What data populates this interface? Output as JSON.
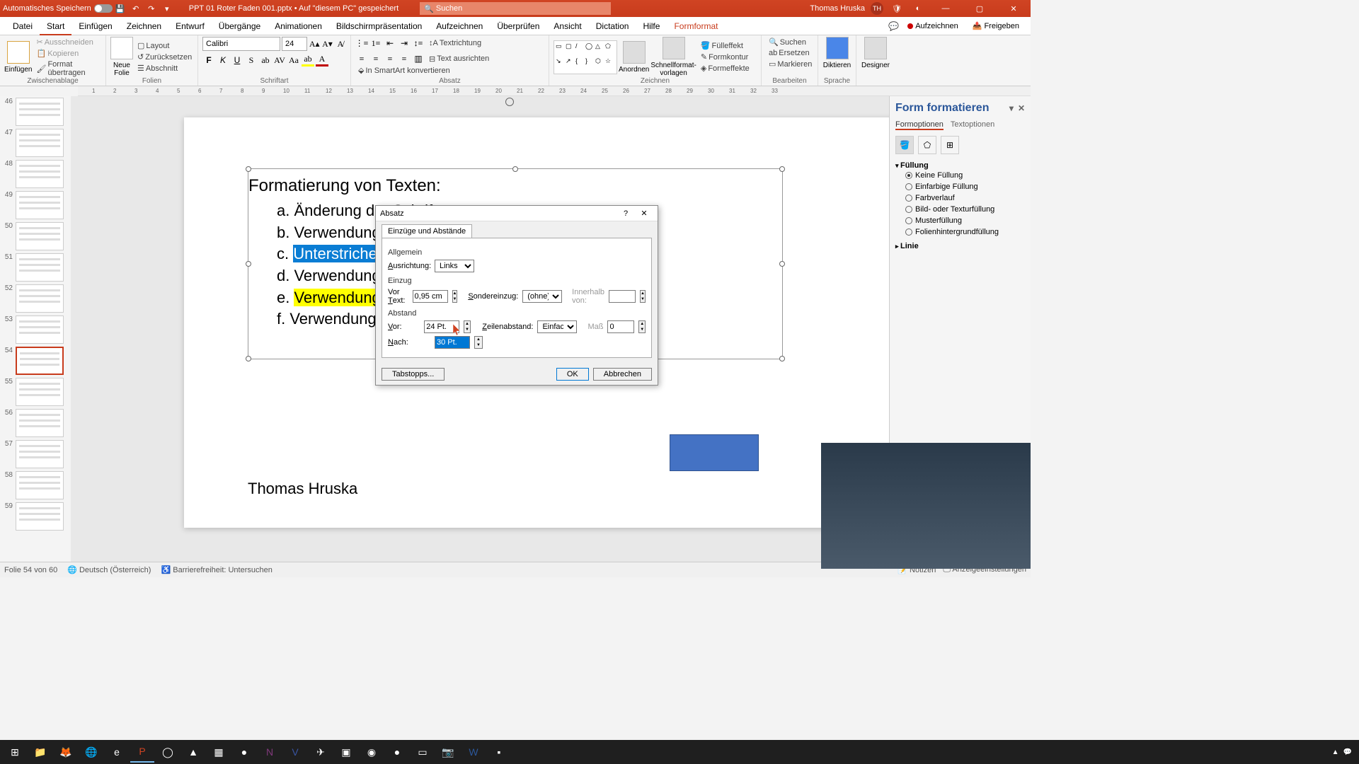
{
  "titlebar": {
    "autosave_label": "Automatisches Speichern",
    "filename": "PPT 01 Roter Faden 001.pptx • Auf \"diesem PC\" gespeichert",
    "search_placeholder": "Suchen",
    "user_name": "Thomas Hruska",
    "user_initials": "TH"
  },
  "tabs": {
    "items": [
      "Datei",
      "Start",
      "Einfügen",
      "Zeichnen",
      "Entwurf",
      "Übergänge",
      "Animationen",
      "Bildschirmpräsentation",
      "Aufzeichnen",
      "Überprüfen",
      "Ansicht",
      "Dictation",
      "Hilfe",
      "Formformat"
    ],
    "active": "Start",
    "aufzeichnen": "Aufzeichnen",
    "freigeben": "Freigeben"
  },
  "ribbon": {
    "clipboard": {
      "paste": "Einfügen",
      "cut": "Ausschneiden",
      "copy": "Kopieren",
      "format_painter": "Format übertragen",
      "label": "Zwischenablage"
    },
    "slides": {
      "new_slide": "Neue\nFolie",
      "layout": "Layout",
      "reset": "Zurücksetzen",
      "section": "Abschnitt",
      "label": "Folien"
    },
    "font": {
      "name": "Calibri",
      "size": "24",
      "label": "Schriftart"
    },
    "paragraph": {
      "label": "Absatz",
      "text_direction": "Textrichtung",
      "align_text": "Text ausrichten",
      "smartart": "In SmartArt konvertieren"
    },
    "drawing": {
      "arrange": "Anordnen",
      "quick_styles": "Schnellformat-\nvorlagen",
      "fill": "Fülleffekt",
      "outline": "Formkontur",
      "effects": "Formeffekte",
      "label": "Zeichnen"
    },
    "editing": {
      "find": "Suchen",
      "replace": "Ersetzen",
      "select": "Markieren",
      "label": "Bearbeiten"
    },
    "voice": {
      "dictate": "Diktieren",
      "label": "Sprache"
    },
    "designer": {
      "label": "Designer"
    }
  },
  "thumbs": [
    {
      "n": 46
    },
    {
      "n": 47
    },
    {
      "n": 48
    },
    {
      "n": 49
    },
    {
      "n": 50
    },
    {
      "n": 51
    },
    {
      "n": 52
    },
    {
      "n": 53
    },
    {
      "n": 54,
      "sel": true
    },
    {
      "n": 55
    },
    {
      "n": 56
    },
    {
      "n": 57
    },
    {
      "n": 58
    },
    {
      "n": 59
    }
  ],
  "slide": {
    "title": "Formatierung von Texten",
    "items": [
      {
        "letter": "a.",
        "text": "Änderung der Schrif"
      },
      {
        "letter": "b.",
        "text": "Verwendung von Fe"
      },
      {
        "letter": "c.",
        "text": "Unterstrichen und D",
        "hl": "blue"
      },
      {
        "letter": "d.",
        "text": "Verwendung von Sc"
      },
      {
        "letter": "e.",
        "text": "Verwendung von Te",
        "hl": "yellow"
      },
      {
        "letter": "f.",
        "text": "Verwendung von Abs                                          ählungen"
      }
    ],
    "author": "Thomas Hruska"
  },
  "dialog": {
    "title": "Absatz",
    "tab": "Einzüge und Abstände",
    "general_label": "Allgemein",
    "alignment_label": "Ausrichtung:",
    "alignment_value": "Links",
    "indent_label": "Einzug",
    "before_text_label": "Vor Text:",
    "before_text_value": "0,95 cm",
    "special_label": "Sondereinzug:",
    "special_value": "(ohne)",
    "by_label": "Innerhalb von:",
    "spacing_label": "Abstand",
    "before_label": "Vor:",
    "before_value": "24 Pt.",
    "line_spacing_label": "Zeilenabstand:",
    "line_spacing_value": "Einfach",
    "at_label": "Maß",
    "at_value": "0",
    "after_label": "Nach:",
    "after_value": "30 Pt.",
    "tabstops": "Tabstopps...",
    "ok": "OK",
    "cancel": "Abbrechen"
  },
  "format_pane": {
    "title": "Form formatieren",
    "subtabs": [
      "Formoptionen",
      "Textoptionen"
    ],
    "fill_label": "Füllung",
    "fill_options": [
      "Keine Füllung",
      "Einfarbige Füllung",
      "Farbverlauf",
      "Bild- oder Texturfüllung",
      "Musterfüllung",
      "Folienhintergrundfüllung"
    ],
    "fill_checked": "Keine Füllung",
    "line_label": "Linie"
  },
  "statusbar": {
    "slide_info": "Folie 54 von 60",
    "language": "Deutsch (Österreich)",
    "accessibility": "Barrierefreiheit: Untersuchen",
    "notes": "Notizen",
    "display": "Anzeigeeinstellungen"
  },
  "ruler_ticks": [
    1,
    2,
    3,
    4,
    5,
    6,
    7,
    8,
    9,
    10,
    11,
    12,
    13,
    14,
    15,
    16,
    17,
    18,
    19,
    20,
    21,
    22,
    23,
    24,
    25,
    26,
    27,
    28,
    29,
    30,
    31,
    32,
    33
  ]
}
